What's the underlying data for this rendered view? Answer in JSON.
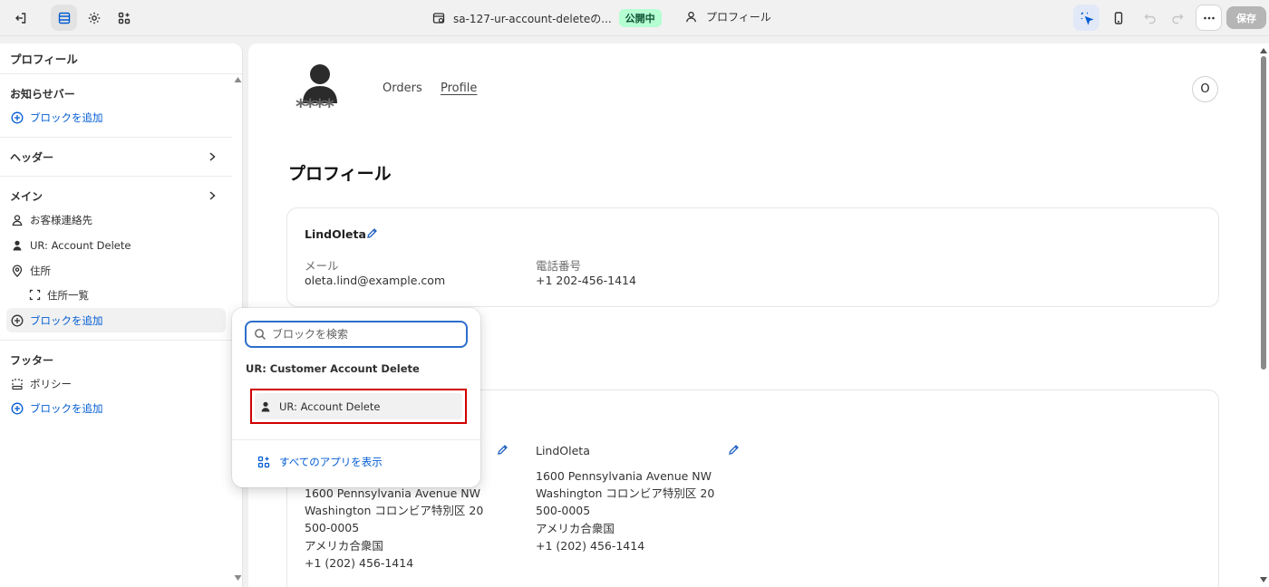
{
  "topbar": {
    "theme_title": "sa-127-ur-account-deleteの...",
    "status_badge": "公開中",
    "page_name": "プロフィール",
    "save_label": "保存"
  },
  "sidebar": {
    "title": "プロフィール",
    "announcement_bar": "お知らせバー",
    "add_block_1": "ブロックを追加",
    "header": "ヘッダー",
    "main": "メイン",
    "items": [
      {
        "label": "お客様連絡先",
        "icon": "person-outline-icon"
      },
      {
        "label": "UR: Account Delete",
        "icon": "person-filled-icon"
      },
      {
        "label": "住所",
        "icon": "location-pin-icon"
      },
      {
        "label": "住所一覧",
        "icon": "dashed-square-icon"
      }
    ],
    "add_block_2": "ブロックを追加",
    "footer": "フッター",
    "policy": "ポリシー",
    "add_block_3": "ブロックを追加"
  },
  "preview": {
    "logo_text": "****",
    "nav": [
      "Orders",
      "Profile"
    ],
    "avatar_initial": "O",
    "page_title": "プロフィール",
    "profile_card": {
      "name": "LindOleta",
      "email_label": "メール",
      "email": "oleta.lind@example.com",
      "phone_label": "電話番号",
      "phone": "+1 202-456-1414"
    },
    "address_card": {
      "left_address": [
        "1600 Pennsylvania Avenue NW",
        "Washington コロンビア特別区 20",
        "500-0005",
        "アメリカ合衆国",
        "+1 (202) 456-1414"
      ],
      "right_name": "LindOleta",
      "right_address": [
        "1600 Pennsylvania Avenue NW",
        "Washington コロンビア特別区 20",
        "500-0005",
        "アメリカ合衆国",
        "+1 (202) 456-1414"
      ]
    }
  },
  "popover": {
    "search_placeholder": "ブロックを検索",
    "group_title": "UR: Customer Account Delete",
    "item_label": "UR: Account Delete",
    "view_all_apps": "すべてのアプリを表示"
  },
  "colors": {
    "accent_blue": "#005bd3",
    "badge_bg": "#b4fed2",
    "highlight_red": "#d10000"
  }
}
